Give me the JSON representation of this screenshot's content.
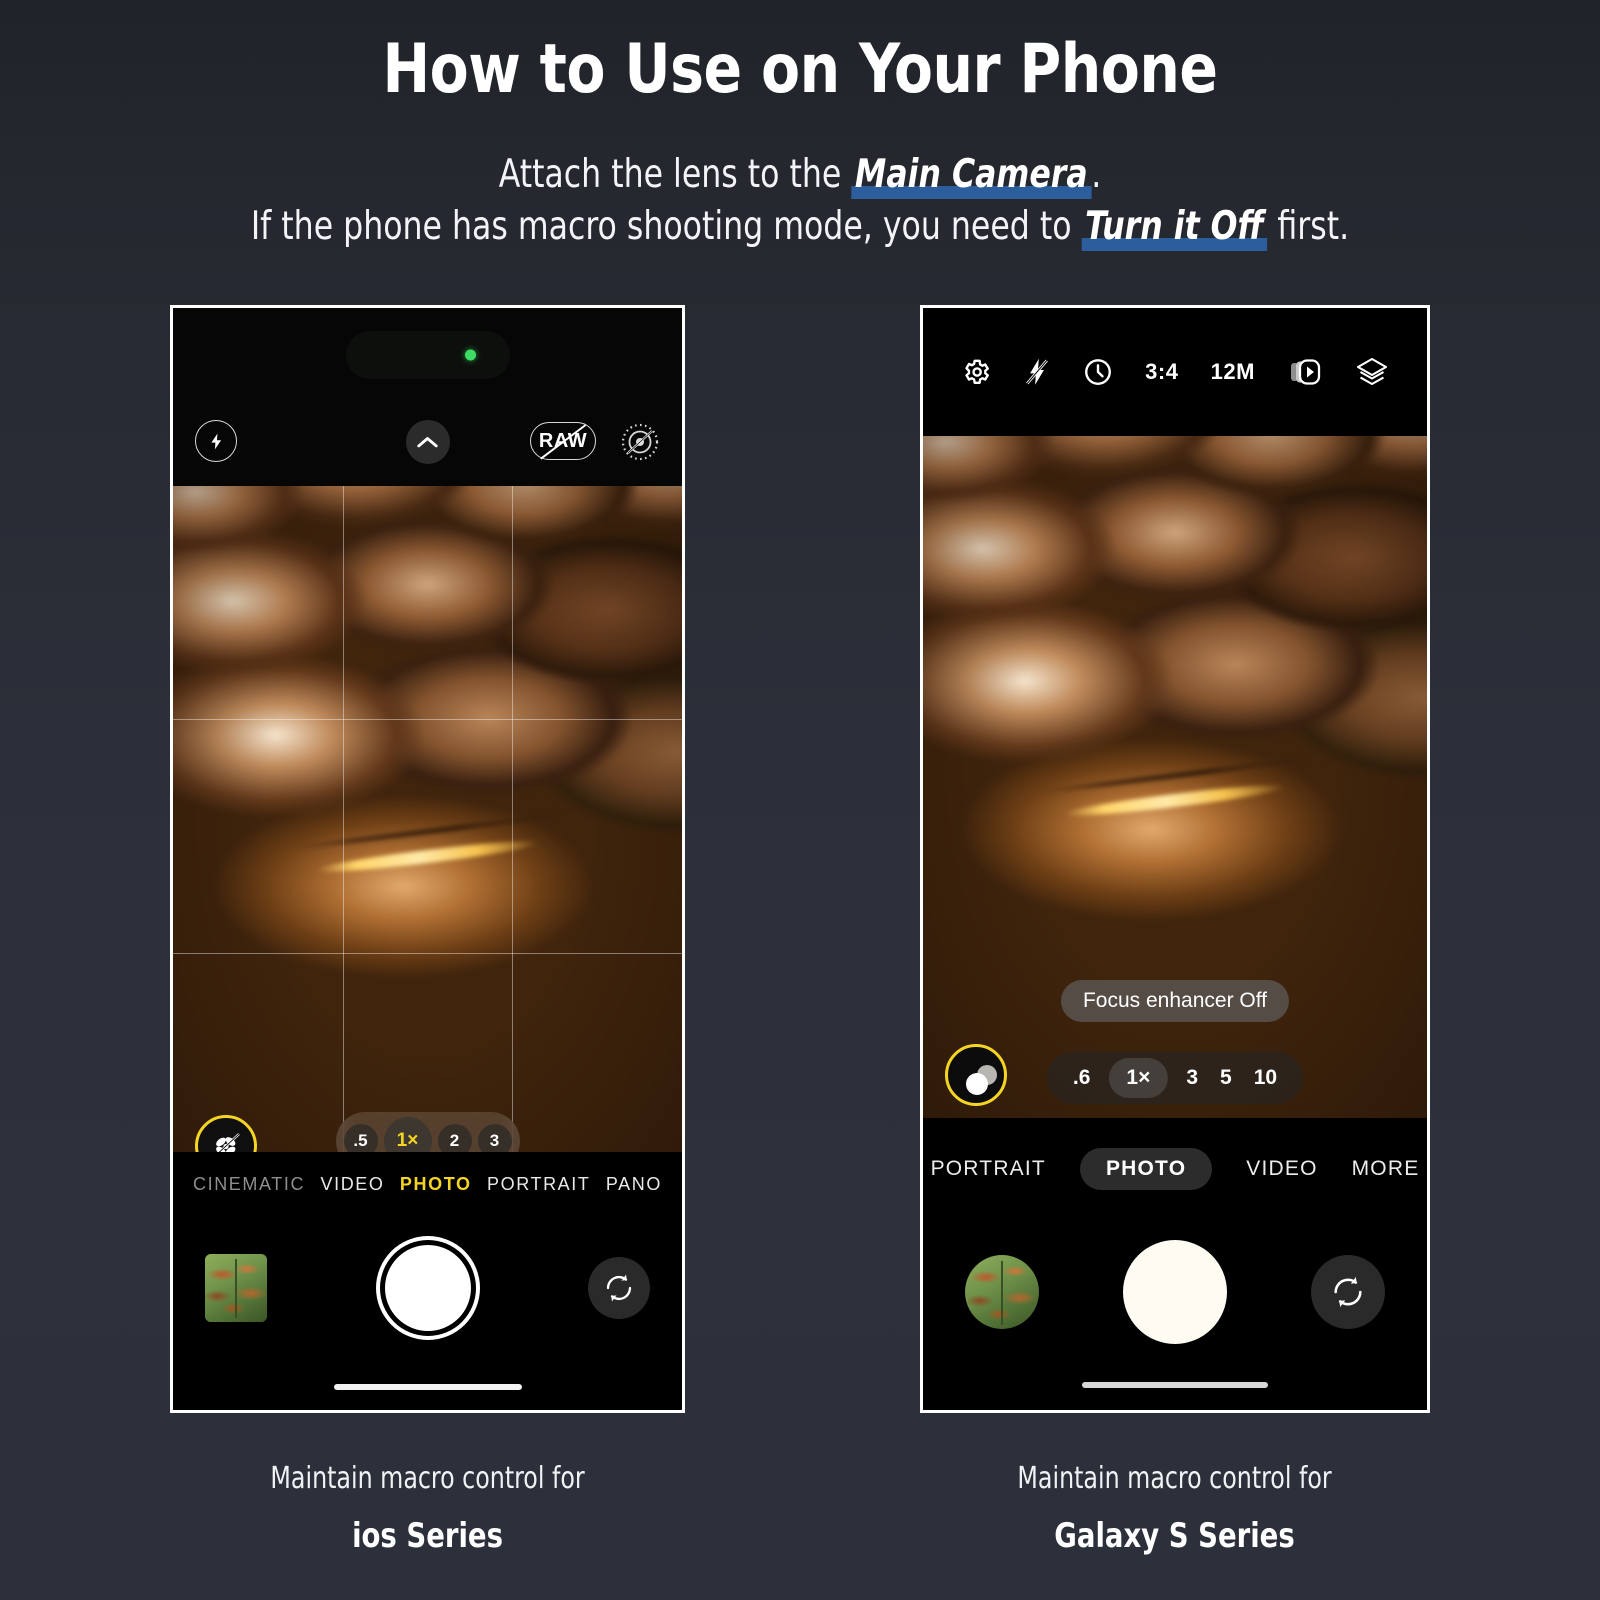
{
  "header": {
    "title": "How to Use on Your Phone",
    "line1_pre": "Attach the lens to the ",
    "line1_hl": "Main Camera",
    "line1_post": ".",
    "line2_pre": "If the phone has macro shooting mode, you need to ",
    "line2_hl": "Turn it Off",
    "line2_post": " first.",
    "highlight_color": "#2c5e9e"
  },
  "ios": {
    "topbar": {
      "flash_icon": "flash-icon",
      "chevron_icon": "chevron-up-icon",
      "raw_label": "RAW",
      "raw_icon": "raw-off-icon",
      "live_icon": "live-photo-off-icon",
      "island_indicator": "green-recording-dot"
    },
    "macro_button": {
      "icon": "macro-off-icon",
      "ring_color": "#f5d524",
      "state": "off"
    },
    "zoom": {
      "options": [
        ".5",
        "1×",
        "2",
        "3"
      ],
      "active": "1×",
      "active_color": "#f5d524"
    },
    "modes": [
      "CINEMATIC",
      "VIDEO",
      "PHOTO",
      "PORTRAIT",
      "PANO"
    ],
    "active_mode": "PHOTO",
    "active_mode_color": "#f5d524",
    "actions": {
      "thumbnail": "photo-thumbnail",
      "shutter": "shutter-button",
      "flip": "flip-camera-icon"
    },
    "caption_line1": "Maintain macro control for",
    "caption_line2": "ios Series"
  },
  "android": {
    "topbar": [
      {
        "name": "settings-gear",
        "type": "icon",
        "label": ""
      },
      {
        "name": "flash-off",
        "type": "icon",
        "label": ""
      },
      {
        "name": "timer",
        "type": "icon",
        "label": ""
      },
      {
        "name": "aspect-ratio",
        "type": "text",
        "label": "3:4"
      },
      {
        "name": "resolution",
        "type": "text",
        "label": "12M"
      },
      {
        "name": "motion-photo",
        "type": "icon",
        "label": ""
      },
      {
        "name": "filters",
        "type": "icon",
        "label": ""
      }
    ],
    "toast": "Focus enhancer Off",
    "focus_button": {
      "icon": "focus-enhancer-icon",
      "ring_color": "#f5d524",
      "state": "off"
    },
    "zoom": {
      "options": [
        ".6",
        "1×",
        "3",
        "5",
        "10"
      ],
      "active": "1×"
    },
    "modes": [
      "PORTRAIT",
      "PHOTO",
      "VIDEO",
      "MORE"
    ],
    "active_mode": "PHOTO",
    "actions": {
      "thumbnail": "photo-thumbnail",
      "shutter": "shutter-button",
      "flip": "flip-camera-icon"
    },
    "caption_line1": "Maintain macro control for",
    "caption_line2": "Galaxy S Series"
  }
}
